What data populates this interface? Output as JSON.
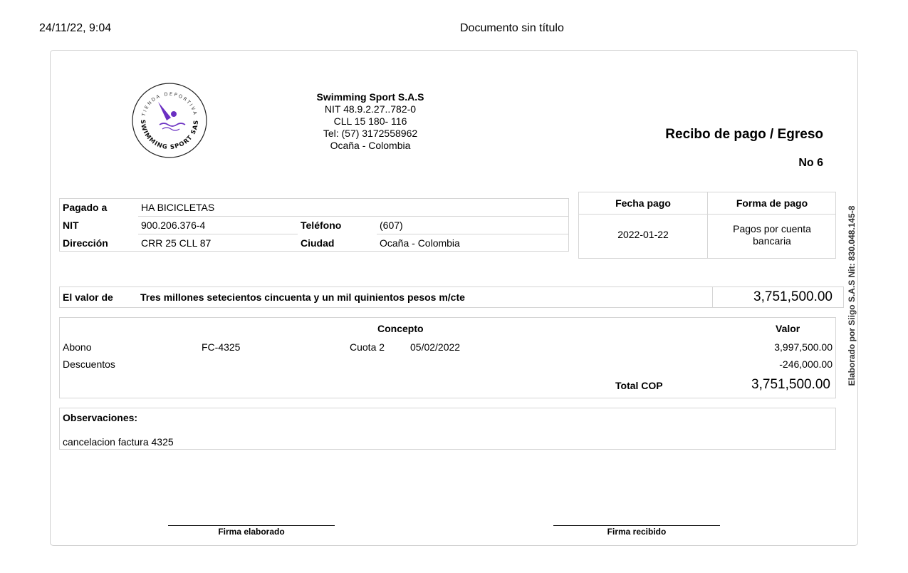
{
  "browser_header": {
    "print_datetime": "24/11/22, 9:04",
    "document_title": "Documento sin título"
  },
  "logo": {
    "top_text": "TIENDA DEPORTIVA",
    "bottom_text": "SWIMMING SPORT SAS",
    "accent_color": "#6a2fc2"
  },
  "company": {
    "name": "Swimming Sport S.A.S",
    "nit": "NIT 48.9.2.27..782-0",
    "address": "CLL 15 180- 116",
    "phone": "Tel: (57) 3172558962",
    "city": "Ocaña - Colombia"
  },
  "receipt": {
    "title": "Recibo de pago / Egreso",
    "number": "No 6"
  },
  "payee": {
    "paid_to_label": "Pagado a",
    "paid_to": "HA BICICLETAS",
    "nit_label": "NIT",
    "nit": "900.206.376-4",
    "phone_label": "Teléfono",
    "phone": "(607)",
    "address_label": "Dirección",
    "address": "CRR 25 CLL 87",
    "city_label": "Ciudad",
    "city": "Ocaña - Colombia"
  },
  "payment": {
    "date_label": "Fecha pago",
    "date": "2022-01-22",
    "method_label": "Forma de pago",
    "method": "Pagos por cuenta bancaria"
  },
  "amount": {
    "label": "El valor de",
    "words": "Tres millones setecientos cincuenta y un mil quinientos pesos m/cte",
    "value": "3,751,500.00"
  },
  "concept": {
    "header_concept": "Concepto",
    "header_value": "Valor",
    "rows": [
      {
        "type": "Abono",
        "ref": "FC-4325",
        "installment": "Cuota 2",
        "date": "05/02/2022",
        "value": "3,997,500.00"
      },
      {
        "type": "Descuentos",
        "ref": "",
        "installment": "",
        "date": "",
        "value": "-246,000.00"
      }
    ],
    "total_label": "Total COP",
    "total_value": "3,751,500.00"
  },
  "observations": {
    "label": "Observaciones:",
    "text": "cancelacion factura 4325"
  },
  "signatures": {
    "prepared": "Firma elaborado",
    "received": "Firma recibido"
  },
  "side_credit": "Elaborado por Siigo S.A.S Nit: 830.048.145-8"
}
